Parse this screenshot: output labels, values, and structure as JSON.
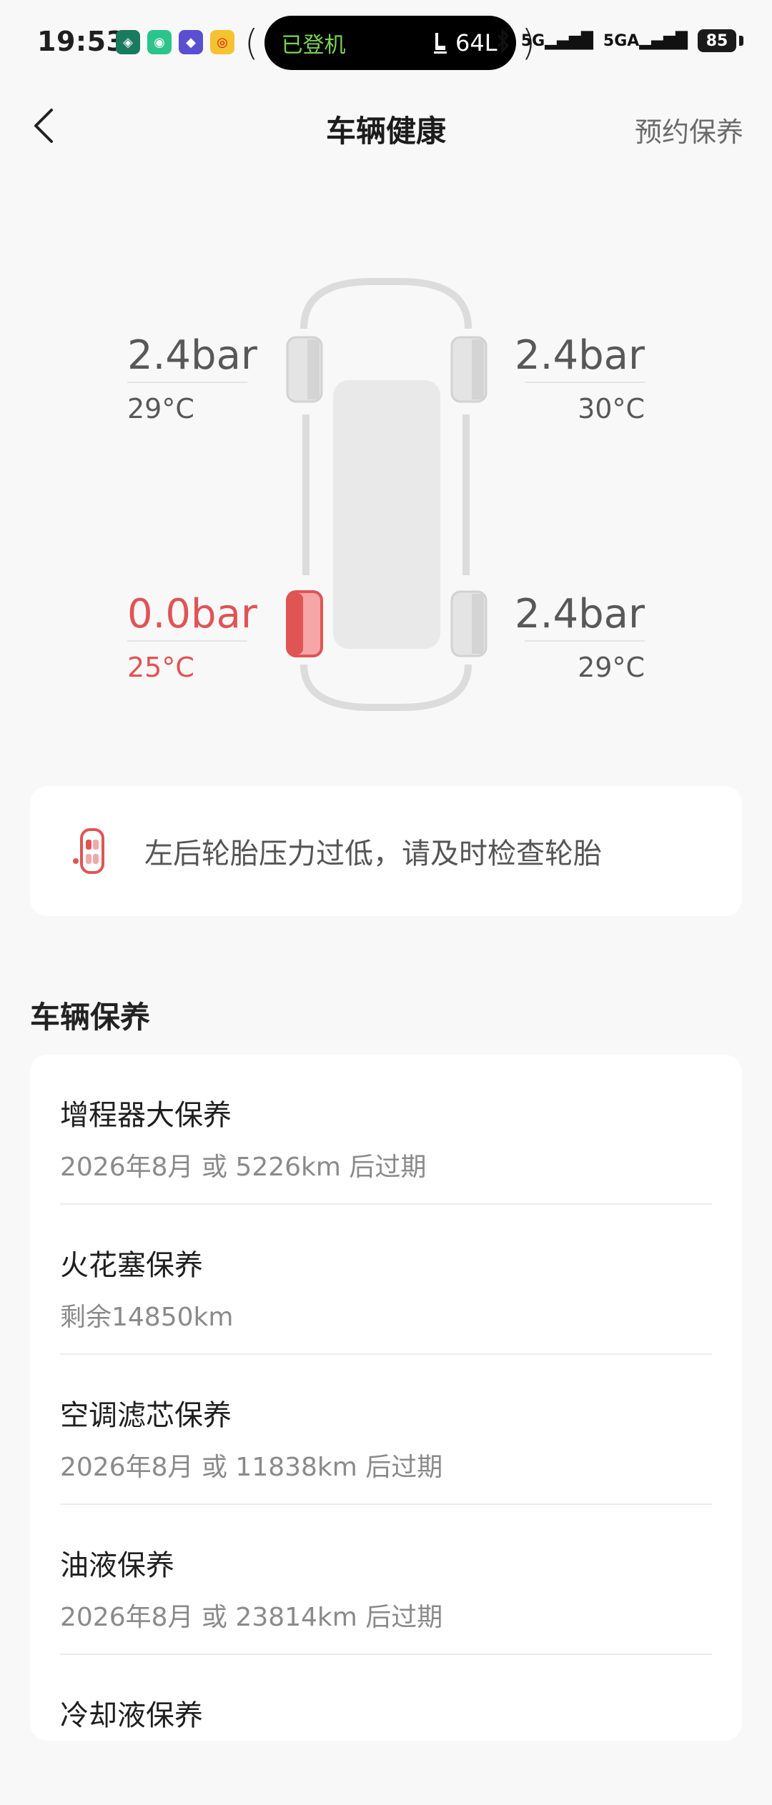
{
  "status_bar": {
    "time": "19:53",
    "pill_status": "已登机",
    "pill_value": "64L",
    "signal_1": "5G",
    "signal_2": "5GA",
    "battery": "85"
  },
  "header": {
    "title": "车辆健康",
    "action": "预约保养"
  },
  "tires": {
    "front_left": {
      "pressure": "2.4bar",
      "temp": "29°C",
      "warning": false
    },
    "front_right": {
      "pressure": "2.4bar",
      "temp": "30°C",
      "warning": false
    },
    "rear_left": {
      "pressure": "0.0bar",
      "temp": "25°C",
      "warning": true
    },
    "rear_right": {
      "pressure": "2.4bar",
      "temp": "29°C",
      "warning": false
    }
  },
  "alert": {
    "message": "左后轮胎压力过低，请及时检查轮胎"
  },
  "maintenance": {
    "title": "车辆保养",
    "items": [
      {
        "name": "增程器大保养",
        "detail": "2026年8月 或 5226km 后过期"
      },
      {
        "name": "火花塞保养",
        "detail": "剩余14850km"
      },
      {
        "name": "空调滤芯保养",
        "detail": "2026年8月 或 11838km 后过期"
      },
      {
        "name": "油液保养",
        "detail": "2026年8月 或 23814km 后过期"
      },
      {
        "name": "冷却液保养",
        "detail": ""
      }
    ]
  },
  "colors": {
    "warning": "#e05454",
    "pill_text": "#7bd34f",
    "background": "#f8f8f8"
  }
}
